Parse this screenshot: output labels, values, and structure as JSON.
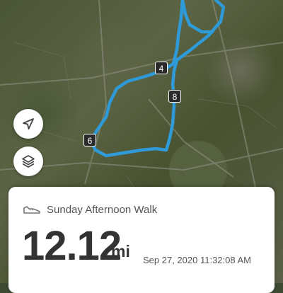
{
  "map": {
    "route_color": "#2f9ad8",
    "markers": [
      {
        "label": "4"
      },
      {
        "label": "8"
      },
      {
        "label": "6"
      }
    ]
  },
  "controls": {
    "navigate_icon": "navigate-arrow-icon",
    "layers_icon": "layers-icon"
  },
  "activity": {
    "icon": "shoe-icon",
    "name": "Sunday Afternoon Walk",
    "distance": "12.12",
    "unit": "mi",
    "datetime": "Sep 27, 2020 11:32:08 AM"
  }
}
